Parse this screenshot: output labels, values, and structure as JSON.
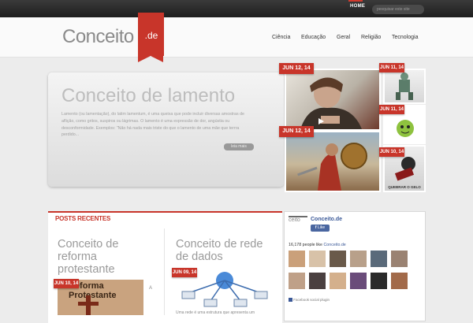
{
  "topbar": {
    "home_label": "HOME",
    "search_placeholder": "pesquisar este site"
  },
  "logo": {
    "text": "Conceito",
    "tld": ".de"
  },
  "nav": [
    "Ciência",
    "Educação",
    "Geral",
    "Religião",
    "Tecnologia"
  ],
  "hero": {
    "title": "Conceito de lamento",
    "excerpt": "Lamento (ou lamentação), do latim lamentum, é uma queixa que pode incluir diversas amostras de aflição, como gritos, suspiros ou lágrimas. O lamento é uma expressão de dor, angústia ou desconformidade. Exemplos: \"Não há nada mais triste do que o lamento de uma mãe que terrra perdido...",
    "read_more": "leia mais"
  },
  "gallery": {
    "tags": [
      "JUN 12, 14",
      "JUN 12, 14",
      "JUN 11, 14",
      "JUN 11, 14",
      "JUN 10, 14"
    ],
    "caption": "QUEBRAR O GELO"
  },
  "posts": {
    "heading": "POSTS RECENTES",
    "items": [
      {
        "title": "Conceito de reforma protestante",
        "date": "JUN 10, 14",
        "image_text": "Reforma Protestante"
      },
      {
        "title": "Conceito de rede de dados",
        "date": "JUN 09, 14",
        "snippet": "Uma rede é uma estrutura que apresenta um"
      }
    ]
  },
  "facebook": {
    "logo_text": "ceito",
    "page_name": "Conceito.de",
    "like_label": "Like",
    "count_text": "16,178 people like",
    "count_link": "Conceito.de",
    "plugin_label": "Facebook social plugin"
  },
  "colors": {
    "accent": "#c8352a",
    "facebook": "#3b5998"
  }
}
